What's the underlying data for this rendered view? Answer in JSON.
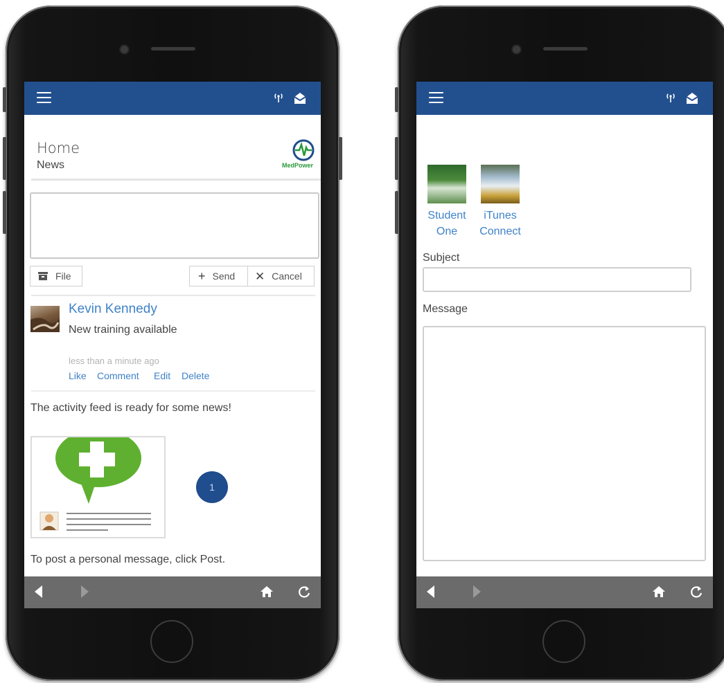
{
  "colors": {
    "brand_bar": "#22508f",
    "link": "#3f82c8",
    "badge": "#1f4d8d",
    "bottom_bar": "#6b6b6b"
  },
  "left_screen": {
    "header": {
      "menu_icon": "hamburger-icon",
      "signal_icon": "signal-icon",
      "mail_icon": "mail-icon"
    },
    "page_title": "Home",
    "page_subtitle": "News",
    "logo_text": "MedPower",
    "composer": {
      "post_placeholder": "",
      "file_label": "File",
      "send_label": "Send",
      "cancel_label": "Cancel"
    },
    "post": {
      "author": "Kevin Kennedy",
      "text": "New training available",
      "time": "less than a minute ago",
      "actions": [
        "Like",
        "Comment",
        "Edit",
        "Delete"
      ]
    },
    "feed_message": "The activity feed is ready for some news!",
    "badge_count": "1",
    "instructions": "To post a personal message, click Post."
  },
  "right_screen": {
    "contacts": [
      {
        "name_line1": "Student",
        "name_line2": "One"
      },
      {
        "name_line1": "iTunes",
        "name_line2": "Connect"
      }
    ],
    "subject_label": "Subject",
    "subject_value": "",
    "message_label": "Message",
    "message_value": ""
  },
  "bottom_nav": {
    "icons": [
      "back-icon",
      "forward-icon",
      "home-icon",
      "refresh-icon"
    ]
  }
}
